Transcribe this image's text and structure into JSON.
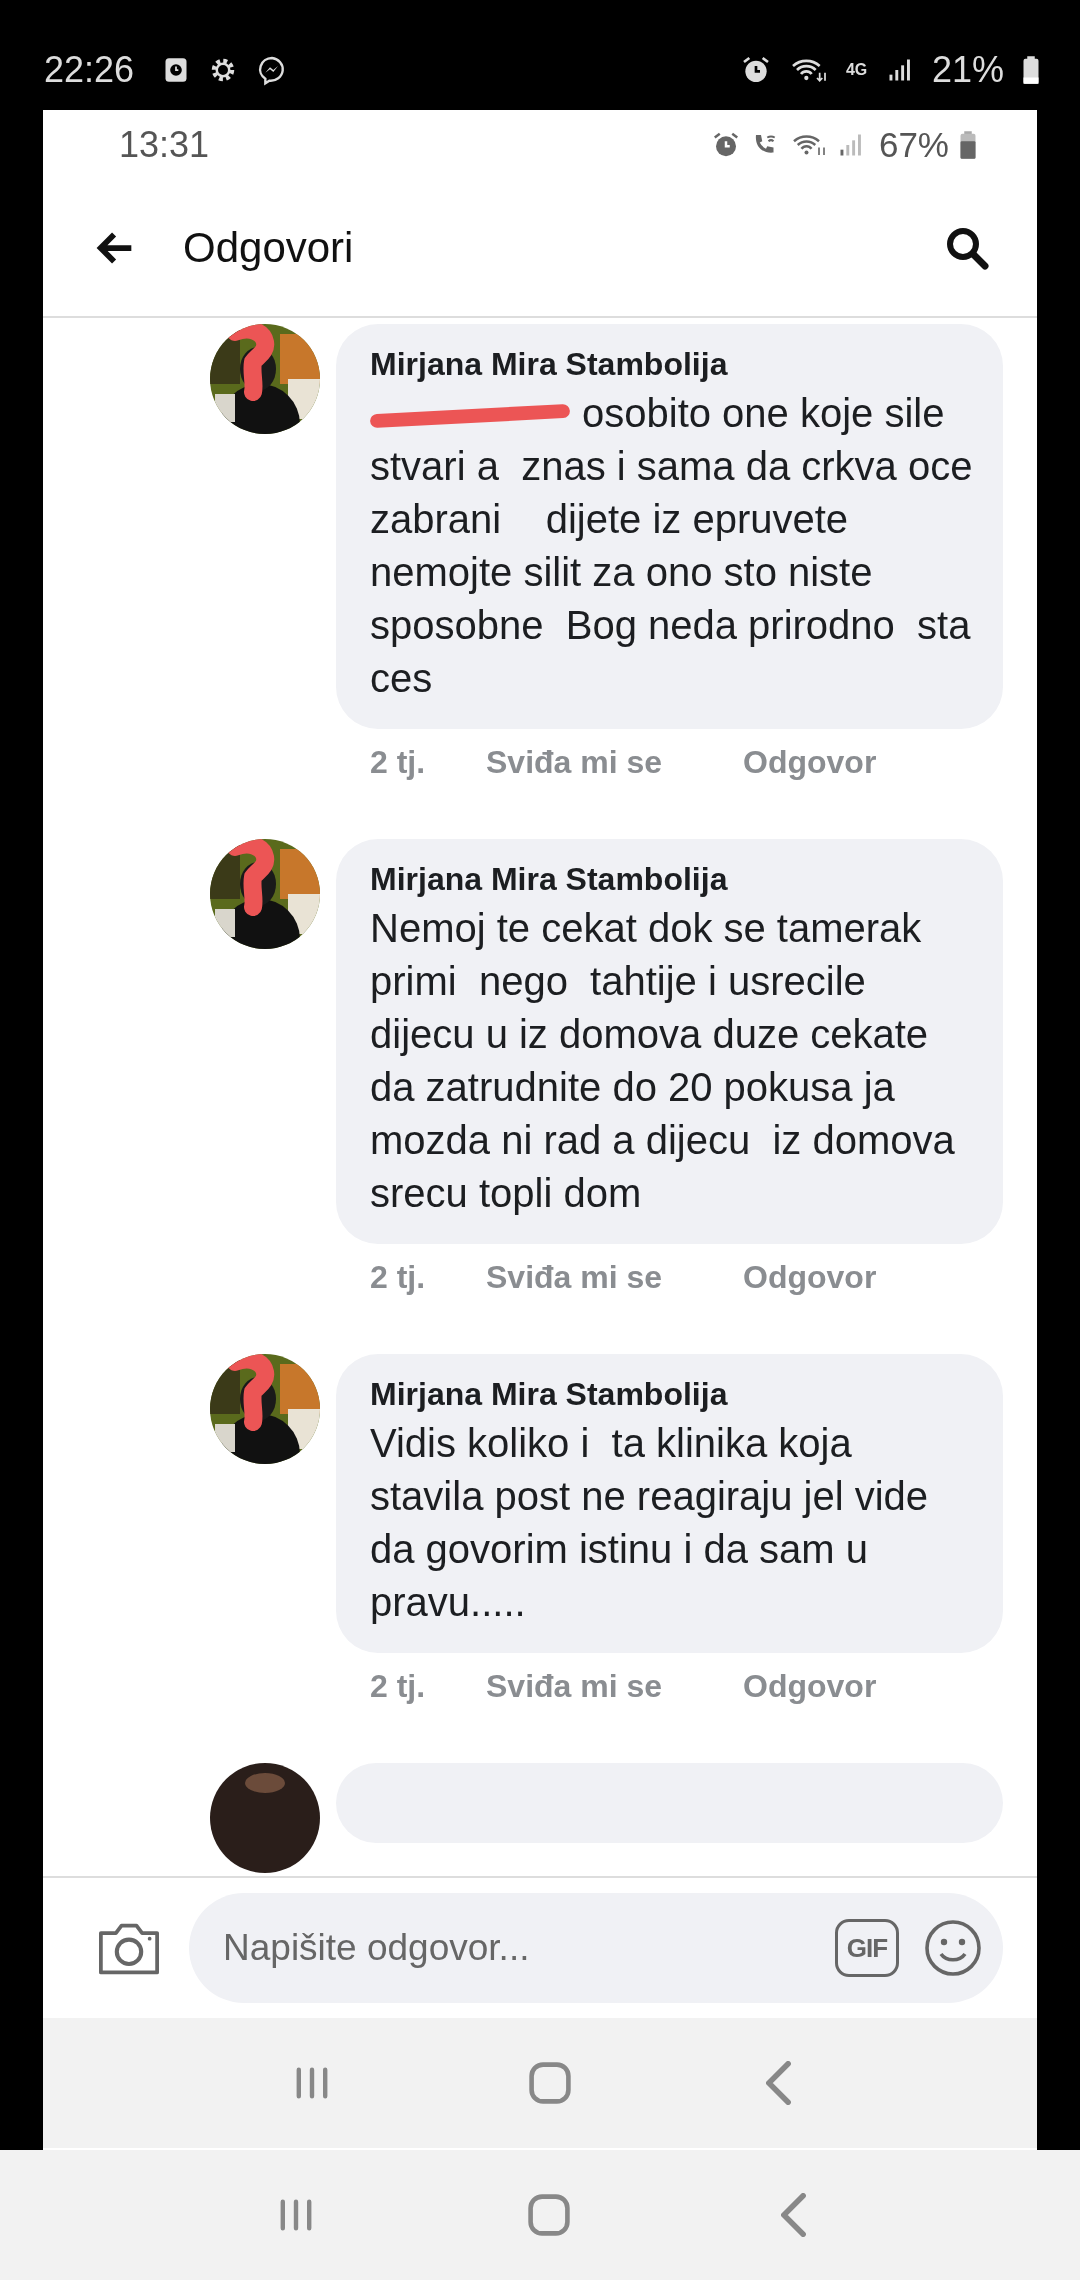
{
  "outer_status": {
    "time": "22:26",
    "network": "4G",
    "battery": "21%"
  },
  "inner_status": {
    "time": "13:31",
    "battery": "67%"
  },
  "app_bar": {
    "title": "Odgovori"
  },
  "comments": [
    {
      "kind": "comment",
      "author": "Mirjana Mira Stambolija",
      "redacted": true,
      "text": "osobito one koje sile stvari a  znas i sama da crkva oce zabrani    dijete iz epruvete   nemojte silit za ono sto niste sposobne  Bog neda prirodno  sta ces",
      "age": "2 tj.",
      "like": "Sviđa mi se",
      "reply": "Odgovor"
    },
    {
      "kind": "comment",
      "author": "Mirjana Mira Stambolija",
      "redacted": false,
      "text": "Nemoj te cekat dok se tamerak primi  nego  tahtije i usrecile dijecu u iz domova duze cekate da zatrudnite do 20 pokusa ja mozda ni rad a dijecu  iz domova srecu topli dom",
      "age": "2 tj.",
      "like": "Sviđa mi se",
      "reply": "Odgovor"
    },
    {
      "kind": "comment",
      "author": "Mirjana Mira Stambolija",
      "redacted": false,
      "text": "Vidis koliko i  ta klinika koja stavila post ne reagiraju jel vide da govorim istinu i da sam u pravu.....",
      "age": "2 tj.",
      "like": "Sviđa mi se",
      "reply": "Odgovor"
    },
    {
      "kind": "partial"
    }
  ],
  "composer": {
    "placeholder": "Napišite odgovor...",
    "gif_label": "GIF"
  }
}
